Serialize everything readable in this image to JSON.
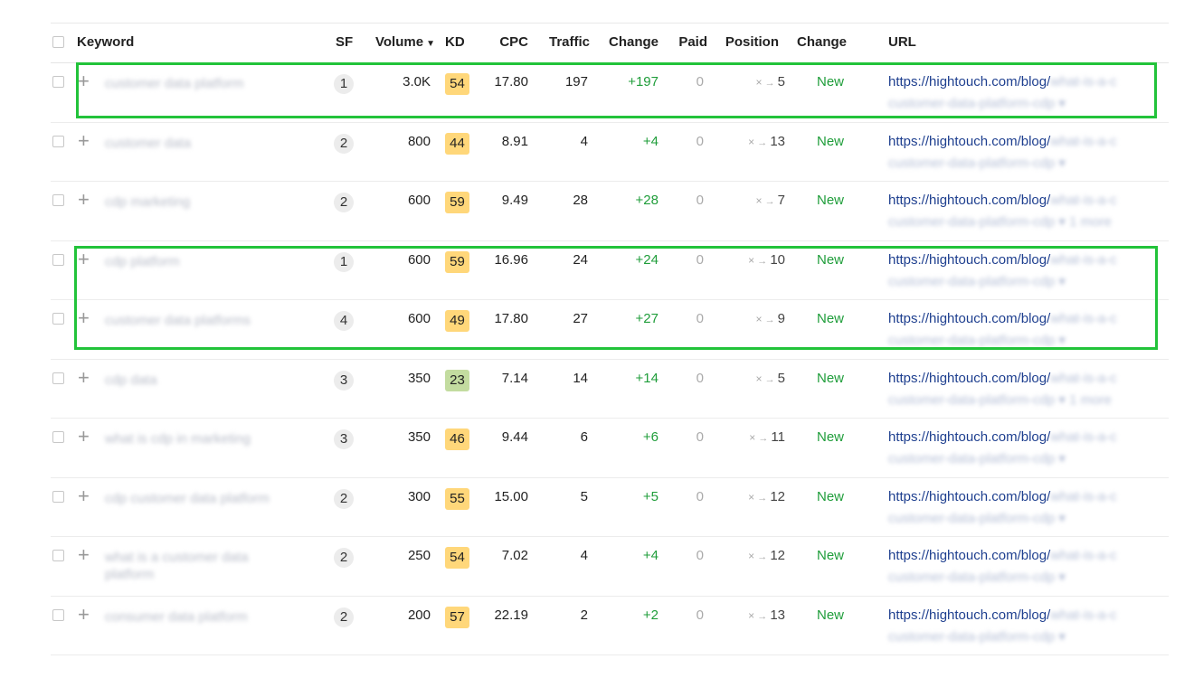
{
  "columns": {
    "keyword": "Keyword",
    "sf": "SF",
    "volume": "Volume",
    "kd": "KD",
    "cpc": "CPC",
    "traffic": "Traffic",
    "change": "Change",
    "paid": "Paid",
    "position": "Position",
    "change2": "Change",
    "url": "URL",
    "volume_sort_icon": "caret-down-icon"
  },
  "colors": {
    "kd_yellow": "#ffd77a",
    "kd_green": "#c3dca0",
    "positive": "#1f9d3a",
    "link": "#1e3f8f",
    "highlight": "#22c33a"
  },
  "rows": [
    {
      "keyword": "customer data platform",
      "sf": "1",
      "volume": "3.0K",
      "kd": "54",
      "kd_color": "#ffd77a",
      "cpc": "17.80",
      "traffic": "197",
      "change": "+197",
      "paid": "0",
      "pos_from": "×",
      "pos_to": "5",
      "status": "New",
      "url": "https://hightouch.com/blog/",
      "url_rest": "what-is-a-c",
      "url_line2": "customer-data-platform-cdp ▾"
    },
    {
      "keyword": "customer data",
      "sf": "2",
      "volume": "800",
      "kd": "44",
      "kd_color": "#ffd77a",
      "cpc": "8.91",
      "traffic": "4",
      "change": "+4",
      "paid": "0",
      "pos_from": "×",
      "pos_to": "13",
      "status": "New",
      "url": "https://hightouch.com/blog/",
      "url_rest": "what-is-a-c",
      "url_line2": "customer-data-platform-cdp ▾"
    },
    {
      "keyword": "cdp marketing",
      "sf": "2",
      "volume": "600",
      "kd": "59",
      "kd_color": "#ffd77a",
      "cpc": "9.49",
      "traffic": "28",
      "change": "+28",
      "paid": "0",
      "pos_from": "×",
      "pos_to": "7",
      "status": "New",
      "url": "https://hightouch.com/blog/",
      "url_rest": "what-is-a-c",
      "url_line2": "customer-data-platform-cdp ▾  1 more"
    },
    {
      "keyword": "cdp platform",
      "sf": "1",
      "volume": "600",
      "kd": "59",
      "kd_color": "#ffd77a",
      "cpc": "16.96",
      "traffic": "24",
      "change": "+24",
      "paid": "0",
      "pos_from": "×",
      "pos_to": "10",
      "status": "New",
      "url": "https://hightouch.com/blog/",
      "url_rest": "what-is-a-c",
      "url_line2": "customer-data-platform-cdp ▾"
    },
    {
      "keyword": "customer data platforms",
      "sf": "4",
      "volume": "600",
      "kd": "49",
      "kd_color": "#ffd77a",
      "cpc": "17.80",
      "traffic": "27",
      "change": "+27",
      "paid": "0",
      "pos_from": "×",
      "pos_to": "9",
      "status": "New",
      "url": "https://hightouch.com/blog/",
      "url_rest": "what-is-a-c",
      "url_line2": "customer-data-platform-cdp ▾"
    },
    {
      "keyword": "cdp data",
      "sf": "3",
      "volume": "350",
      "kd": "23",
      "kd_color": "#c3dca0",
      "cpc": "7.14",
      "traffic": "14",
      "change": "+14",
      "paid": "0",
      "pos_from": "×",
      "pos_to": "5",
      "status": "New",
      "url": "https://hightouch.com/blog/",
      "url_rest": "what-is-a-c",
      "url_line2": "customer-data-platform-cdp ▾  1 more"
    },
    {
      "keyword": "what is cdp in marketing",
      "sf": "3",
      "volume": "350",
      "kd": "46",
      "kd_color": "#ffd77a",
      "cpc": "9.44",
      "traffic": "6",
      "change": "+6",
      "paid": "0",
      "pos_from": "×",
      "pos_to": "11",
      "status": "New",
      "url": "https://hightouch.com/blog/",
      "url_rest": "what-is-a-c",
      "url_line2": "customer-data-platform-cdp ▾"
    },
    {
      "keyword": "cdp customer data platform",
      "sf": "2",
      "volume": "300",
      "kd": "55",
      "kd_color": "#ffd77a",
      "cpc": "15.00",
      "traffic": "5",
      "change": "+5",
      "paid": "0",
      "pos_from": "×",
      "pos_to": "12",
      "status": "New",
      "url": "https://hightouch.com/blog/",
      "url_rest": "what-is-a-c",
      "url_line2": "customer-data-platform-cdp ▾"
    },
    {
      "keyword": "what is a customer data platform",
      "sf": "2",
      "volume": "250",
      "kd": "54",
      "kd_color": "#ffd77a",
      "cpc": "7.02",
      "traffic": "4",
      "change": "+4",
      "paid": "0",
      "pos_from": "×",
      "pos_to": "12",
      "status": "New",
      "url": "https://hightouch.com/blog/",
      "url_rest": "what-is-a-c",
      "url_line2": "customer-data-platform-cdp ▾"
    },
    {
      "keyword": "consumer data platform",
      "sf": "2",
      "volume": "200",
      "kd": "57",
      "kd_color": "#ffd77a",
      "cpc": "22.19",
      "traffic": "2",
      "change": "+2",
      "paid": "0",
      "pos_from": "×",
      "pos_to": "13",
      "status": "New",
      "url": "https://hightouch.com/blog/",
      "url_rest": "what-is-a-c",
      "url_line2": "customer-data-platform-cdp ▾"
    }
  ]
}
